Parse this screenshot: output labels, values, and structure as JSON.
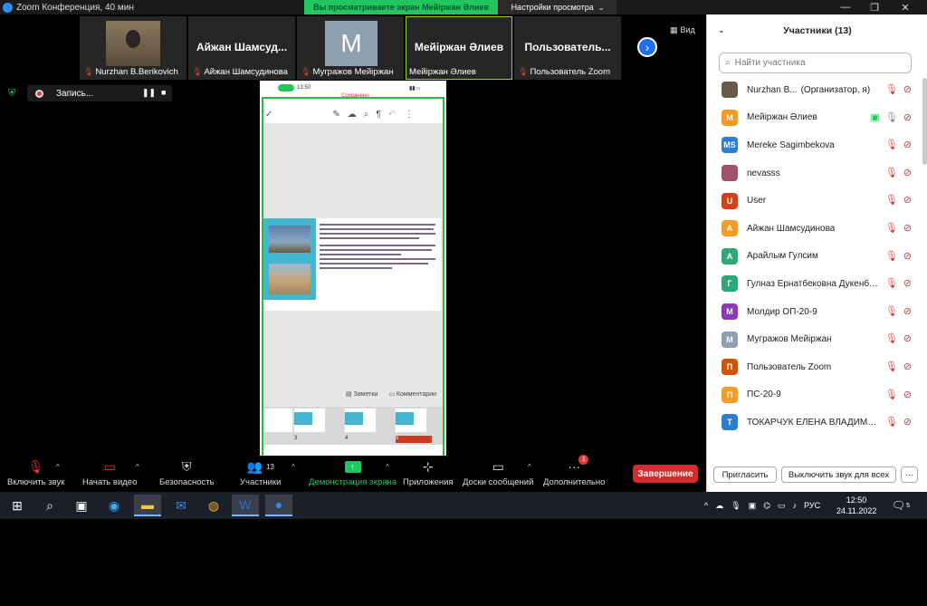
{
  "window": {
    "title": "Zoom Конференция, 40 мин",
    "viewing_banner": "Вы просматриваете экран Мейiржан Әлиев",
    "view_settings": "Настройки просмотра",
    "minimize": "—",
    "restore": "❐",
    "close": "✕"
  },
  "video_strip": {
    "tiles": [
      {
        "big_name": "",
        "caption": "Nurzhan B.Berikovich",
        "kind": "photo"
      },
      {
        "big_name": "Айжан  Шамсуд...",
        "caption": "Айжан Шамсудинова",
        "kind": "name"
      },
      {
        "big_name": "",
        "caption": "Мугражов Мейiржан",
        "kind": "letter",
        "letter": "M"
      },
      {
        "big_name": "Мейiржан Әлиев",
        "caption": "Мейiржан Әлиев",
        "kind": "name"
      },
      {
        "big_name": "Пользователь...",
        "caption": "Пользователь Zoom",
        "kind": "name"
      }
    ],
    "next_icon": "›",
    "view_label": "Вид"
  },
  "recording": {
    "label": "Запись...",
    "pause_icon": "❚❚",
    "stop_icon": "■"
  },
  "shared_screen": {
    "status_time": "13:50",
    "saved_text": "Сохранено",
    "notes_label": "Заметки",
    "comments_label": "Комментарии",
    "thumb_labels": [
      "3",
      "4",
      "5"
    ]
  },
  "toolbar": {
    "mute": "Включить звук",
    "video": "Начать видео",
    "security": "Безопасность",
    "participants": "Участники",
    "participants_count": "13",
    "share": "Демонстрация экрана",
    "apps": "Приложения",
    "whiteboard": "Доски сообщений",
    "more": "Дополнительно",
    "more_badge": "1",
    "end": "Завершение"
  },
  "panel": {
    "title": "Участники (13)",
    "search_placeholder": "Найти участника",
    "participants": [
      {
        "name": "Nurzhan B...",
        "role": "(Организатор, я)",
        "initials": "",
        "color": "#6b5a4a"
      },
      {
        "name": "Мейiржан Әлиев",
        "role": "",
        "initials": "M",
        "color": "#f59a23"
      },
      {
        "name": "Mereke Sagimbekova",
        "role": "",
        "initials": "MS",
        "color": "#2d7dd2"
      },
      {
        "name": "nevasss",
        "role": "",
        "initials": "",
        "color": "#a0526e"
      },
      {
        "name": "User",
        "role": "",
        "initials": "U",
        "color": "#d3401a"
      },
      {
        "name": "Айжан Шамсудинова",
        "role": "",
        "initials": "A",
        "color": "#f59a23"
      },
      {
        "name": "Арайлым Гулсим",
        "role": "",
        "initials": "A",
        "color": "#2aa876"
      },
      {
        "name": "Гулназ Ернатбековна Дукенбае...",
        "role": "",
        "initials": "Г",
        "color": "#2aa876"
      },
      {
        "name": "Молдир ОП-20-9",
        "role": "",
        "initials": "M",
        "color": "#8a3ab9"
      },
      {
        "name": "Мугражов Мейiржан",
        "role": "",
        "initials": "M",
        "color": "#8fa1b1"
      },
      {
        "name": "Пользователь Zoom",
        "role": "",
        "initials": "П",
        "color": "#d35400"
      },
      {
        "name": "ПС-20-9",
        "role": "",
        "initials": "П",
        "color": "#f59a23"
      },
      {
        "name": "ТОКАРЧУК ЕЛЕНА ВЛАДИМИРОВНА",
        "role": "",
        "initials": "T",
        "color": "#2d7dd2"
      }
    ],
    "invite": "Пригласить",
    "mute_all": "Выключить звук для всех",
    "more": "···"
  },
  "taskbar": {
    "lang": "РУС",
    "time": "12:50",
    "date": "24.11.2022",
    "notifications": "5"
  }
}
